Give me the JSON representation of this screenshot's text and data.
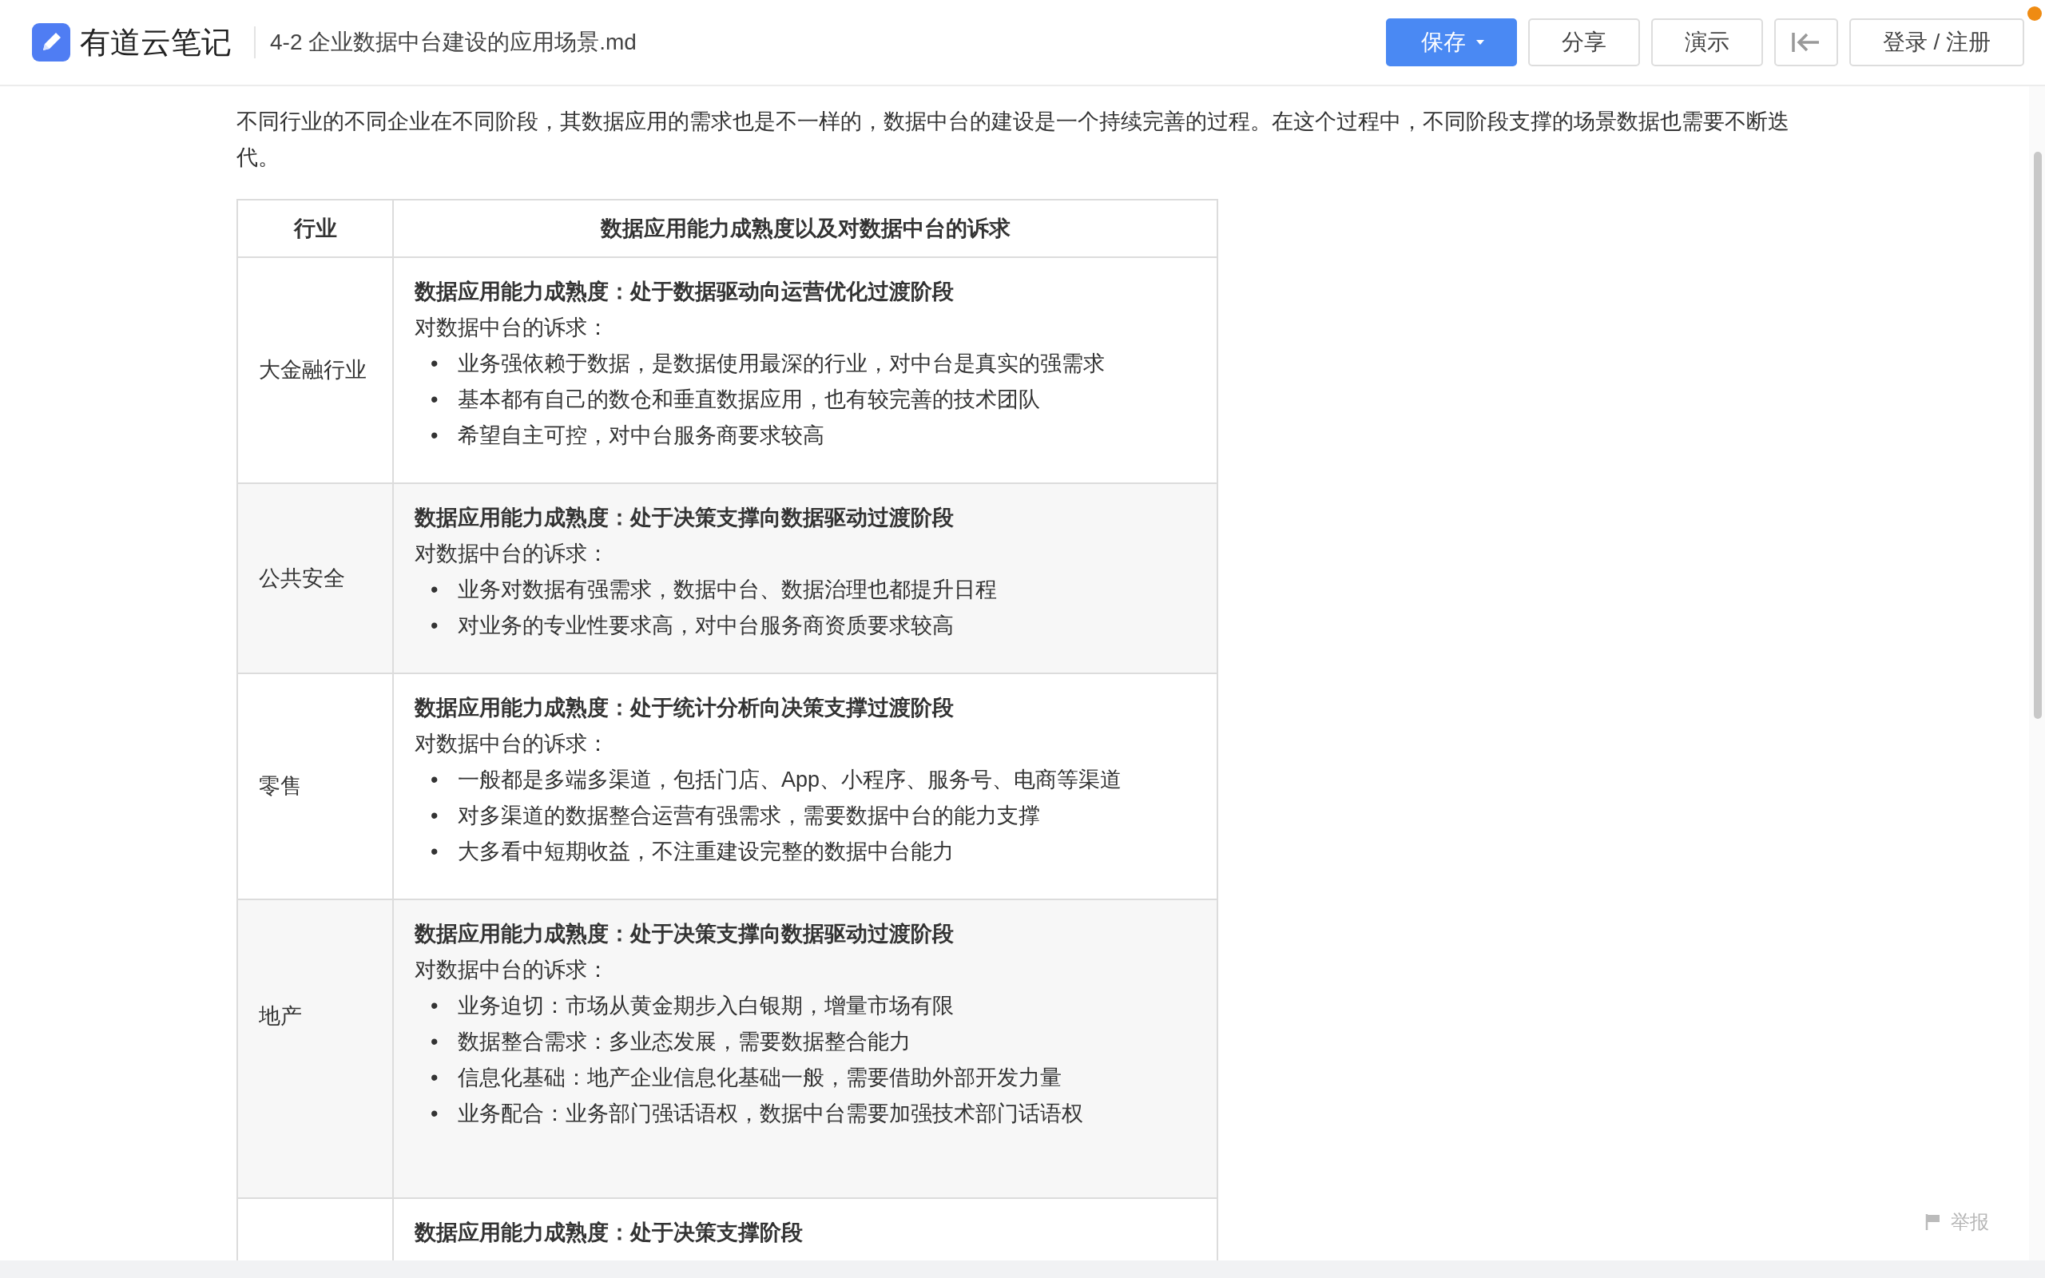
{
  "app": {
    "name": "有道云笔记"
  },
  "document": {
    "title": "4-2 企业数据中台建设的应用场景.md"
  },
  "toolbar": [
    {
      "kind": "primary-dropdown",
      "label": "保存"
    },
    {
      "kind": "default",
      "label": "分享"
    },
    {
      "kind": "default",
      "label": "演示"
    },
    {
      "kind": "collapse"
    },
    {
      "kind": "default",
      "label": "登录 / 注册"
    }
  ],
  "intro": "不同行业的不同企业在不同阶段，其数据应用的需求也是不一样的，数据中台的建设是一个持续完善的过程。在这个过程中，不同阶段支撑的场景数据也需要不断迭代。",
  "table": {
    "list_marker": "•",
    "columns": [
      "行业",
      "数据应用能力成熟度以及对数据中台的诉求"
    ],
    "rows": [
      {
        "industry": "大金融行业",
        "maturity": "数据应用能力成熟度：处于数据驱动向运营优化过渡阶段",
        "demand_label": "对数据中台的诉求：",
        "demands": [
          "业务强依赖于数据，是数据使用最深的行业，对中台是真实的强需求",
          "基本都有自己的数仓和垂直数据应用，也有较完善的技术团队",
          "希望自主可控，对中台服务商要求较高"
        ]
      },
      {
        "industry": "公共安全",
        "maturity": "数据应用能力成熟度：处于决策支撑向数据驱动过渡阶段",
        "demand_label": "对数据中台的诉求：",
        "demands": [
          "业务对数据有强需求，数据中台、数据治理也都提升日程",
          "对业务的专业性要求高，对中台服务商资质要求较高"
        ]
      },
      {
        "industry": "零售",
        "maturity": "数据应用能力成熟度：处于统计分析向决策支撑过渡阶段",
        "demand_label": "对数据中台的诉求：",
        "demands": [
          "一般都是多端多渠道，包括门店、App、小程序、服务号、电商等渠道",
          "对多渠道的数据整合运营有强需求，需要数据中台的能力支撑",
          "大多看中短期收益，不注重建设完整的数据中台能力"
        ]
      },
      {
        "industry": "地产",
        "maturity": "数据应用能力成熟度：处于决策支撑向数据驱动过渡阶段",
        "demand_label": "对数据中台的诉求：",
        "demands": [
          "业务迫切：市场从黄金期步入白银期，增量市场有限",
          "数据整合需求：多业态发展，需要数据整合能力",
          "信息化基础：地产企业信息化基础一般，需要借助外部开发力量",
          "业务配合：业务部门强话语权，数据中台需要加强技术部门话语权"
        ]
      },
      {
        "maturity": "数据应用能力成熟度：处于决策支撑阶段"
      }
    ]
  },
  "report_link": {
    "label": "举报"
  }
}
